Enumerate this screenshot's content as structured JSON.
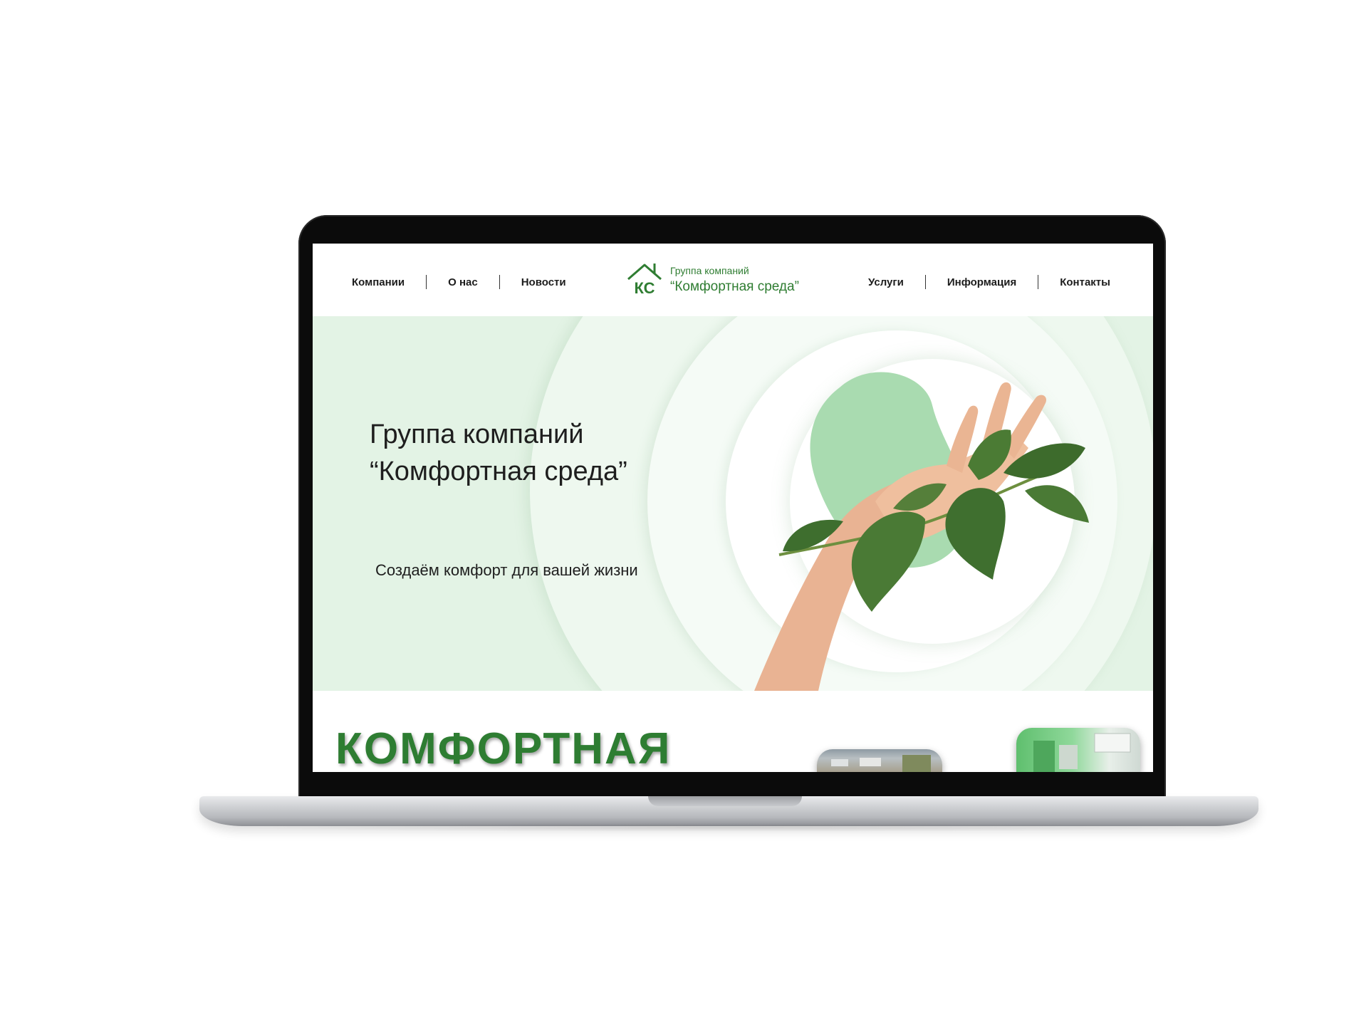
{
  "nav": {
    "left": [
      "Компании",
      "О нас",
      "Новости"
    ],
    "right": [
      "Услуги",
      "Информация",
      "Контакты"
    ]
  },
  "brand": {
    "logo_letters": "КС",
    "line1": "Группа компаний",
    "line2": "“Комфортная среда”"
  },
  "hero": {
    "title_line1": "Группа компаний",
    "title_line2": "“Комфортная среда”",
    "subtitle": "Создаём комфорт для вашей жизни",
    "illustration": "hand-with-leaves"
  },
  "section": {
    "headline": "КОМФОРТНАЯ"
  },
  "colors": {
    "brand_green": "#2f7d32",
    "hero_bg": "#e3f3e5",
    "blob_green": "#a9dbb0"
  }
}
